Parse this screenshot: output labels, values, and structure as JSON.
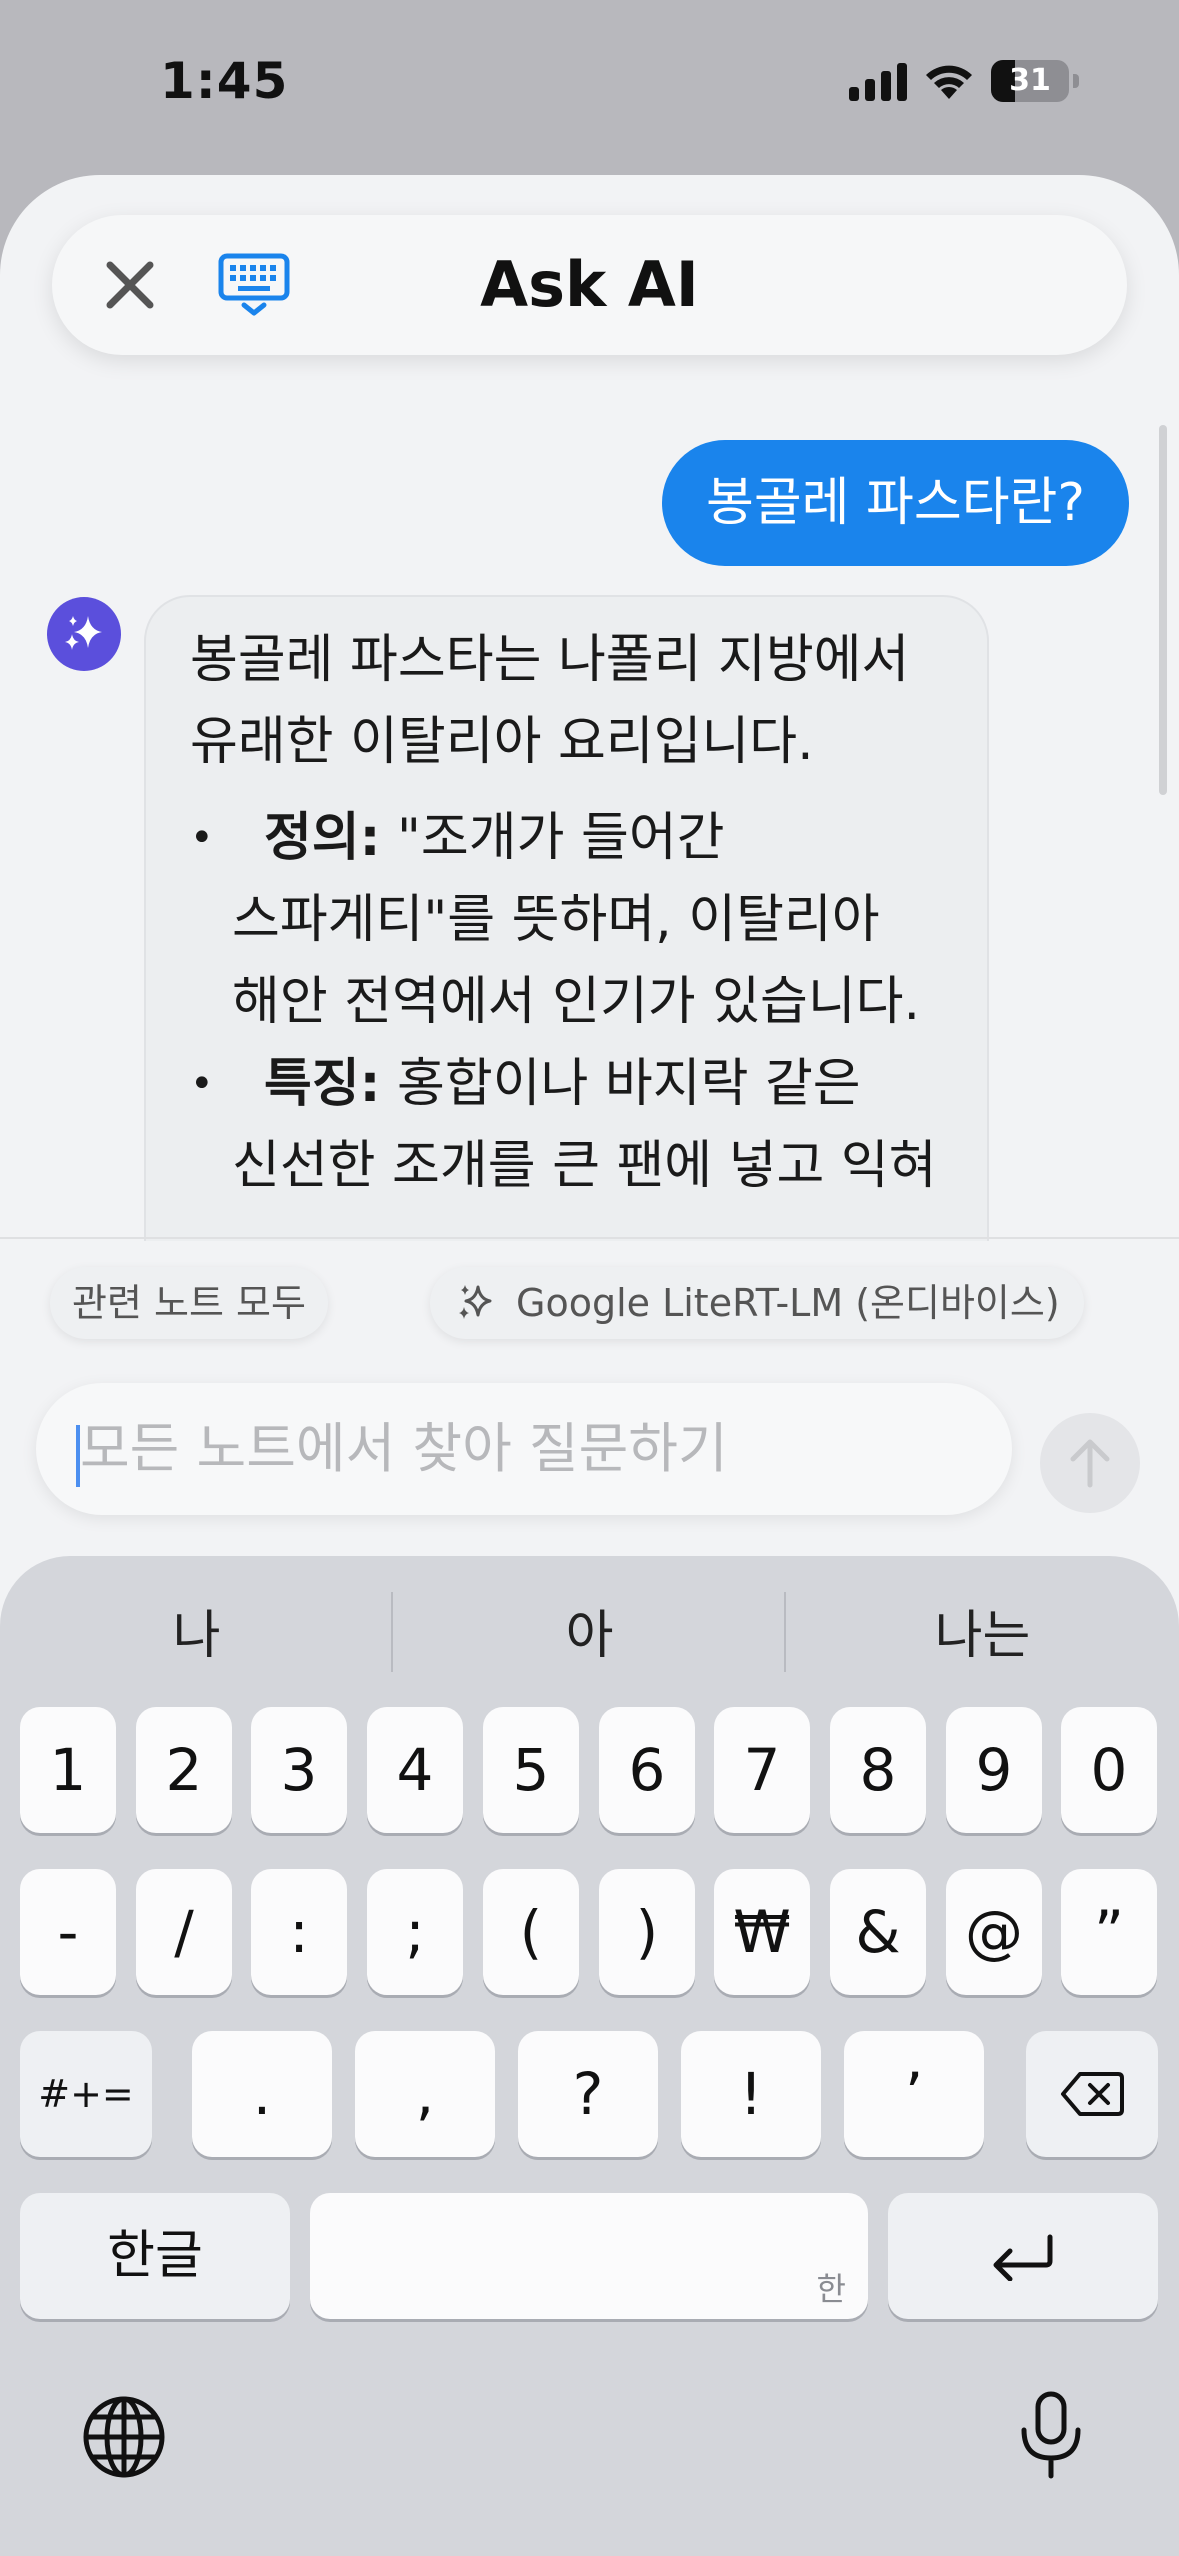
{
  "status_bar": {
    "time": "1:45",
    "battery": "31",
    "battery_level": 0.31
  },
  "header": {
    "title": "Ask AI",
    "close_icon": "close-icon",
    "keyboard_icon": "keyboard-dismiss-icon",
    "accent": "#1a84ec"
  },
  "chat": {
    "user_message": "봉골레 파스타란?",
    "ai_intro": [
      "봉골레 파스타는 나폴리 지방에서",
      "유래한 이탈리아 요리입니다."
    ],
    "bullets": [
      {
        "term": "정의:",
        "lines": [
          " \"조개가 들어간",
          "스파게티\"를 뜻하며, 이탈리아",
          "해안 전역에서 인기가 있습니다."
        ]
      },
      {
        "term": "특징:",
        "lines": [
          " 홍합이나 바지락 같은",
          "신선한 조개를 큰 팬에 넣고 익혀"
        ]
      }
    ]
  },
  "scope_chip": "관련 노트 모두",
  "model_chip": "Google LiteRT-LM (온디바이스)",
  "input": {
    "placeholder": "모든 노트에서 찾아 질문하기",
    "value": ""
  },
  "keyboard": {
    "suggestions": [
      "나",
      "아",
      "나는"
    ],
    "row1": [
      "1",
      "2",
      "3",
      "4",
      "5",
      "6",
      "7",
      "8",
      "9",
      "0"
    ],
    "row2": [
      "-",
      "/",
      ":",
      ";",
      "(",
      ")",
      "₩",
      "&",
      "@",
      "”"
    ],
    "row3": {
      "symbols": "#+=",
      "keys": [
        ".",
        ",",
        "?",
        "!",
        "’"
      ]
    },
    "lang_key": "한글",
    "space_hint": "한"
  }
}
